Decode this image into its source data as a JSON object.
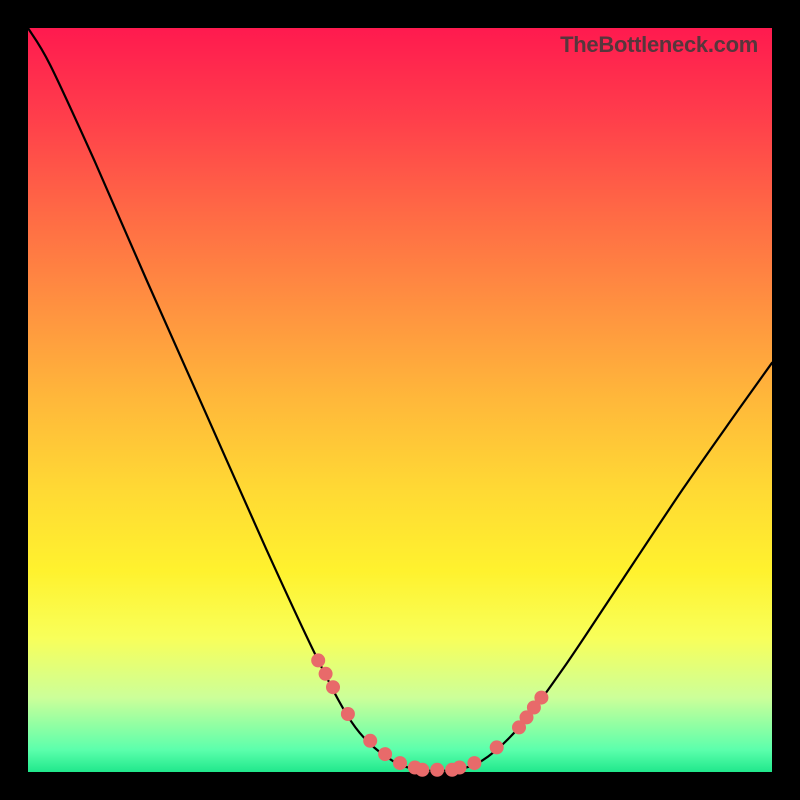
{
  "watermark": "TheBottleneck.com",
  "chart_data": {
    "type": "line",
    "title": "",
    "xlabel": "",
    "ylabel": "",
    "xlim": [
      0,
      100
    ],
    "ylim": [
      0,
      100
    ],
    "grid": false,
    "legend": false,
    "description": "Bottleneck/valley curve on rainbow gradient; y≈0 near x≈55, steep left arm from top-left, shallower right arm toward x=100 y≈55.",
    "curve": [
      {
        "x": 0.0,
        "y": 100.0
      },
      {
        "x": 3.0,
        "y": 95.0
      },
      {
        "x": 9.0,
        "y": 82.0
      },
      {
        "x": 16.0,
        "y": 66.0
      },
      {
        "x": 24.0,
        "y": 48.0
      },
      {
        "x": 32.0,
        "y": 30.0
      },
      {
        "x": 39.0,
        "y": 15.0
      },
      {
        "x": 44.0,
        "y": 6.0
      },
      {
        "x": 49.0,
        "y": 1.5
      },
      {
        "x": 53.0,
        "y": 0.3
      },
      {
        "x": 57.0,
        "y": 0.3
      },
      {
        "x": 61.0,
        "y": 1.5
      },
      {
        "x": 66.0,
        "y": 6.0
      },
      {
        "x": 72.0,
        "y": 14.0
      },
      {
        "x": 80.0,
        "y": 26.0
      },
      {
        "x": 88.0,
        "y": 38.0
      },
      {
        "x": 95.0,
        "y": 48.0
      },
      {
        "x": 100.0,
        "y": 55.0
      }
    ],
    "sample_dots_x": [
      39,
      40,
      41,
      43,
      46,
      48,
      50,
      52,
      53,
      55,
      57,
      58,
      60,
      63,
      66,
      67,
      68,
      69
    ],
    "dot_radius": 7
  }
}
